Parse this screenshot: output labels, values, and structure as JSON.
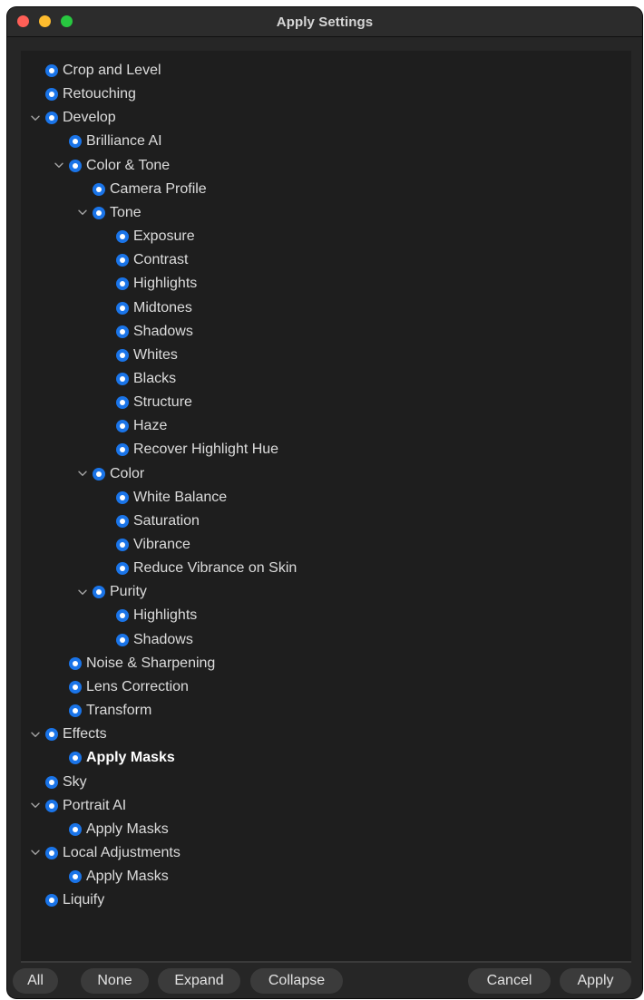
{
  "window": {
    "title": "Apply Settings"
  },
  "tree": {
    "items": [
      {
        "label": "Crop and Level",
        "level": 0,
        "expanded": false
      },
      {
        "label": "Retouching",
        "level": 0,
        "expanded": false
      },
      {
        "label": "Develop",
        "level": 0,
        "expanded": true
      },
      {
        "label": "Brilliance AI",
        "level": 1,
        "expanded": false
      },
      {
        "label": "Color & Tone",
        "level": 1,
        "expanded": true
      },
      {
        "label": "Camera Profile",
        "level": 2,
        "expanded": false
      },
      {
        "label": "Tone",
        "level": 2,
        "expanded": true
      },
      {
        "label": "Exposure",
        "level": 3,
        "expanded": false
      },
      {
        "label": "Contrast",
        "level": 3,
        "expanded": false
      },
      {
        "label": "Highlights",
        "level": 3,
        "expanded": false
      },
      {
        "label": "Midtones",
        "level": 3,
        "expanded": false
      },
      {
        "label": "Shadows",
        "level": 3,
        "expanded": false
      },
      {
        "label": "Whites",
        "level": 3,
        "expanded": false
      },
      {
        "label": "Blacks",
        "level": 3,
        "expanded": false
      },
      {
        "label": "Structure",
        "level": 3,
        "expanded": false
      },
      {
        "label": "Haze",
        "level": 3,
        "expanded": false
      },
      {
        "label": "Recover Highlight Hue",
        "level": 3,
        "expanded": false
      },
      {
        "label": "Color",
        "level": 2,
        "expanded": true
      },
      {
        "label": "White Balance",
        "level": 3,
        "expanded": false
      },
      {
        "label": "Saturation",
        "level": 3,
        "expanded": false
      },
      {
        "label": "Vibrance",
        "level": 3,
        "expanded": false
      },
      {
        "label": "Reduce Vibrance on Skin",
        "level": 3,
        "expanded": false
      },
      {
        "label": "Purity",
        "level": 2,
        "expanded": true
      },
      {
        "label": "Highlights",
        "level": 3,
        "expanded": false
      },
      {
        "label": "Shadows",
        "level": 3,
        "expanded": false
      },
      {
        "label": "Noise & Sharpening",
        "level": 1,
        "expanded": false
      },
      {
        "label": "Lens Correction",
        "level": 1,
        "expanded": false
      },
      {
        "label": "Transform",
        "level": 1,
        "expanded": false
      },
      {
        "label": "Effects",
        "level": 0,
        "expanded": true
      },
      {
        "label": "Apply Masks",
        "level": 1,
        "expanded": false,
        "bold": true
      },
      {
        "label": "Sky",
        "level": 0,
        "expanded": false
      },
      {
        "label": "Portrait AI",
        "level": 0,
        "expanded": true
      },
      {
        "label": "Apply Masks",
        "level": 1,
        "expanded": false
      },
      {
        "label": "Local Adjustments",
        "level": 0,
        "expanded": true
      },
      {
        "label": "Apply Masks",
        "level": 1,
        "expanded": false
      },
      {
        "label": "Liquify",
        "level": 0,
        "expanded": false
      }
    ]
  },
  "buttons": {
    "all": "All",
    "none": "None",
    "expand": "Expand",
    "collapse": "Collapse",
    "cancel": "Cancel",
    "apply": "Apply"
  },
  "colors": {
    "accent": "#1a74e8",
    "window_bg": "#262626",
    "panel_bg": "#1e1e1e",
    "button_bg": "#3b3b3b",
    "text": "#dcdcdc"
  },
  "icons": {
    "expand_chevron": "chevron-down-icon",
    "selected_radio": "radio-selected-icon"
  }
}
